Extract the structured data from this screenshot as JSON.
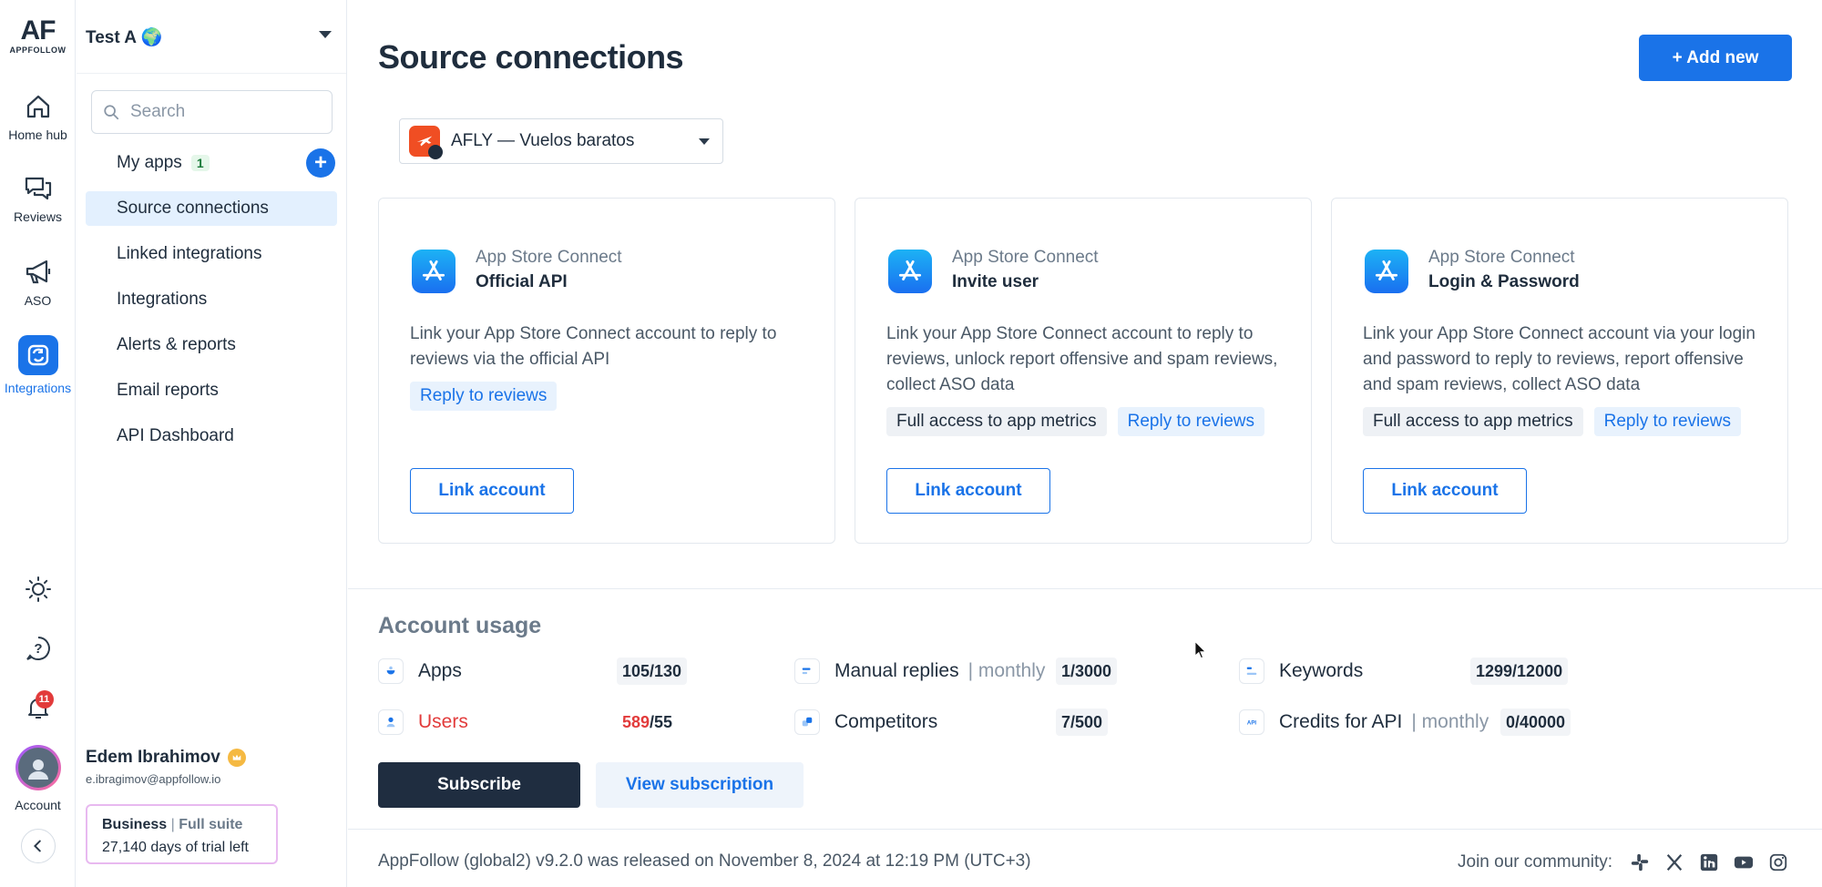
{
  "rail": {
    "logo_main": "AF",
    "logo_sub": "APPFOLLOW",
    "items": [
      {
        "label": "Home hub",
        "icon": "home-icon"
      },
      {
        "label": "Reviews",
        "icon": "reviews-icon"
      },
      {
        "label": "ASO",
        "icon": "megaphone-icon"
      },
      {
        "label": "Integrations",
        "icon": "integrations-icon",
        "active": true
      }
    ],
    "notifications_count": "11",
    "account_label": "Account"
  },
  "sidebar": {
    "workspace": "Test A 🌍",
    "search_placeholder": "Search",
    "nav": [
      {
        "label": "My apps",
        "count": "1"
      },
      {
        "label": "Source connections",
        "active": true
      },
      {
        "label": "Linked integrations"
      },
      {
        "label": "Integrations"
      },
      {
        "label": "Alerts & reports"
      },
      {
        "label": "Email reports"
      },
      {
        "label": "API Dashboard"
      }
    ],
    "user": {
      "name": "Edem Ibrahimov",
      "email": "e.ibragimov@appfollow.io",
      "plan": "Business",
      "plan_sep": "|",
      "plan_suite": "Full suite",
      "trial": "27,140 days of trial left"
    }
  },
  "main": {
    "title": "Source connections",
    "add_new": "+ Add new",
    "app_select": "AFLY — Vuelos baratos",
    "cards": [
      {
        "kicker": "App Store Connect",
        "title": "Official API",
        "desc": "Link your App Store Connect account to reply to reviews via the official API",
        "tags": [
          {
            "label": "Reply to reviews",
            "style": "blue"
          }
        ],
        "button": "Link account"
      },
      {
        "kicker": "App Store Connect",
        "title": "Invite user",
        "desc": "Link your App Store Connect account to reply to reviews, unlock report offensive and spam reviews, collect ASO data",
        "tags": [
          {
            "label": "Full access to app metrics",
            "style": "grey"
          },
          {
            "label": "Reply to reviews",
            "style": "blue"
          }
        ],
        "button": "Link account"
      },
      {
        "kicker": "App Store Connect",
        "title": "Login & Password",
        "desc": "Link your App Store Connect account via your login and password to reply to reviews, report offensive and spam reviews, collect ASO data",
        "tags": [
          {
            "label": "Full access to app metrics",
            "style": "grey"
          },
          {
            "label": "Reply to reviews",
            "style": "blue"
          }
        ],
        "button": "Link account"
      }
    ],
    "usage": {
      "title": "Account usage",
      "metrics": [
        {
          "label": "Apps",
          "value": "105/130"
        },
        {
          "label": "Manual replies",
          "suffix": "| monthly",
          "value": "1/3000"
        },
        {
          "label": "Keywords",
          "value": "1299/12000"
        },
        {
          "label": "Users",
          "value_used": "589",
          "value_total": "/55",
          "over_limit": true
        },
        {
          "label": "Competitors",
          "value": "7/500"
        },
        {
          "label": "Credits for API",
          "suffix": "| monthly",
          "value": "0/40000"
        }
      ],
      "subscribe": "Subscribe",
      "view_subscription": "View subscription"
    },
    "footer": {
      "release": "AppFollow (global2) v9.2.0 was released on November 8, 2024 at 12:19 PM (UTC+3)",
      "community": "Join our community:",
      "social": [
        "slack-icon",
        "x-icon",
        "linkedin-icon",
        "youtube-icon",
        "instagram-icon"
      ]
    }
  },
  "colors": {
    "accent": "#1a73e8",
    "danger": "#e23b3b",
    "dark_button": "#1f2d40"
  }
}
